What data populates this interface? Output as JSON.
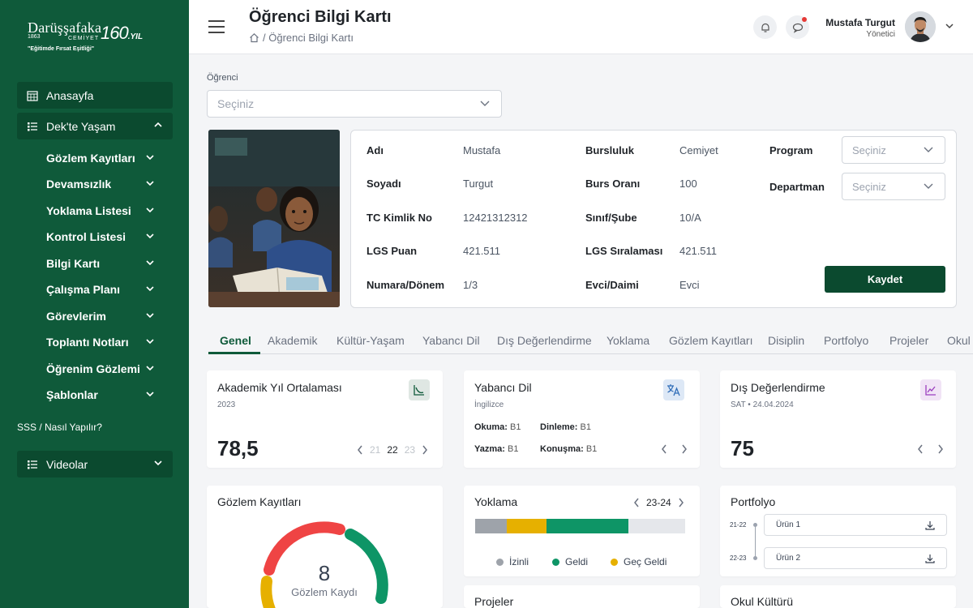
{
  "logo": {
    "brand": "Darüşşafaka",
    "year": "1863",
    "cemiyet": "CEMİYET",
    "slogan": "\"Eğitimde Fırsat Eşitliği\"",
    "anniversary": "160",
    "anniversary_suffix": ".YIL"
  },
  "sidebar": {
    "home": "Anasayfa",
    "dek_life": "Dek'te Yaşam",
    "subitems": [
      "Gözlem Kayıtları",
      "Devamsızlık",
      "Yoklama Listesi",
      "Kontrol Listesi",
      "Bilgi Kartı",
      "Çalışma Planı",
      "Görevlerim",
      "Toplantı Notları",
      "Öğrenim Gözlemi",
      "Şablonlar"
    ],
    "faq": "SSS / Nasıl Yapılır?",
    "videos": "Videolar"
  },
  "header": {
    "title": "Öğrenci Bilgi Kartı",
    "breadcrumb": "/ Öğrenci Bilgi Kartı",
    "user_name": "Mustafa Turgut",
    "user_role": "Yönetici"
  },
  "student_select": {
    "label": "Öğrenci",
    "placeholder": "Seçiniz"
  },
  "info": {
    "left": [
      {
        "label": "Adı",
        "value": "Mustafa"
      },
      {
        "label": "Soyadı",
        "value": "Turgut"
      },
      {
        "label": "TC Kimlik No",
        "value": "12421312312"
      },
      {
        "label": "LGS Puan",
        "value": "421.511"
      },
      {
        "label": "Numara/Dönem",
        "value": "1/3"
      }
    ],
    "right": [
      {
        "label": "Bursluluk",
        "value": "Cemiyet"
      },
      {
        "label": "Burs Oranı",
        "value": "100"
      },
      {
        "label": "Sınıf/Şube",
        "value": "10/A"
      },
      {
        "label": "LGS Sıralaması",
        "value": "421.511"
      },
      {
        "label": "Evci/Daimi",
        "value": "Evci"
      }
    ],
    "program_label": "Program",
    "program_placeholder": "Seçiniz",
    "department_label": "Departman",
    "department_placeholder": "Seçiniz",
    "save": "Kaydet"
  },
  "tabs": [
    "Genel",
    "Akademik",
    "Kültür-Yaşam",
    "Yabancı Dil",
    "Dış Değerlendirme",
    "Yoklama",
    "Gözlem Kayıtları",
    "Disiplin",
    "Portfolyo",
    "Projeler",
    "Okul"
  ],
  "cards": {
    "academic": {
      "title": "Akademik Yıl Ortalaması",
      "sub": "2023",
      "value": "78,5",
      "years": [
        "21",
        "22",
        "23"
      ]
    },
    "language": {
      "title": "Yabancı Dil",
      "sub": "İngilizce",
      "reading_label": "Okuma:",
      "reading": "B1",
      "listening_label": "Dinleme:",
      "listening": "B1",
      "writing_label": "Yazma:",
      "writing": "B1",
      "speaking_label": "Konuşma:",
      "speaking": "B1"
    },
    "external": {
      "title": "Dış Değerlendirme",
      "sub": "SAT • 24.04.2024",
      "value": "75"
    },
    "observation": {
      "title": "Gözlem Kayıtları",
      "count": "8",
      "count_label": "Gözlem Kaydı"
    },
    "attendance": {
      "title": "Yoklama",
      "period": "23-24",
      "segments": [
        {
          "name": "İzinli",
          "fraction": 0.15,
          "color": "#9ea3aa"
        },
        {
          "name": "Geç Geldi",
          "fraction": 0.19,
          "color": "#e6b000"
        },
        {
          "name": "Geldi",
          "fraction": 0.39,
          "color": "#0e9566"
        },
        {
          "name": "",
          "fraction": 0.27,
          "color": "#e5e7eb"
        }
      ],
      "legend": [
        "İzinli",
        "Geldi",
        "Geç Geldi"
      ]
    },
    "portfolio": {
      "title": "Portfolyo",
      "items": [
        {
          "year": "21-22",
          "label": "Ürün 1"
        },
        {
          "year": "22-23",
          "label": "Ürün 2"
        }
      ]
    },
    "projects": {
      "title": "Projeler"
    },
    "culture": {
      "title": "Okul Kültürü"
    }
  },
  "colors": {
    "primary": "#0f5a3a",
    "primary_dark": "#0b4a2f",
    "red": "#e53935",
    "green": "#0e9566",
    "yellow": "#e6b000"
  }
}
